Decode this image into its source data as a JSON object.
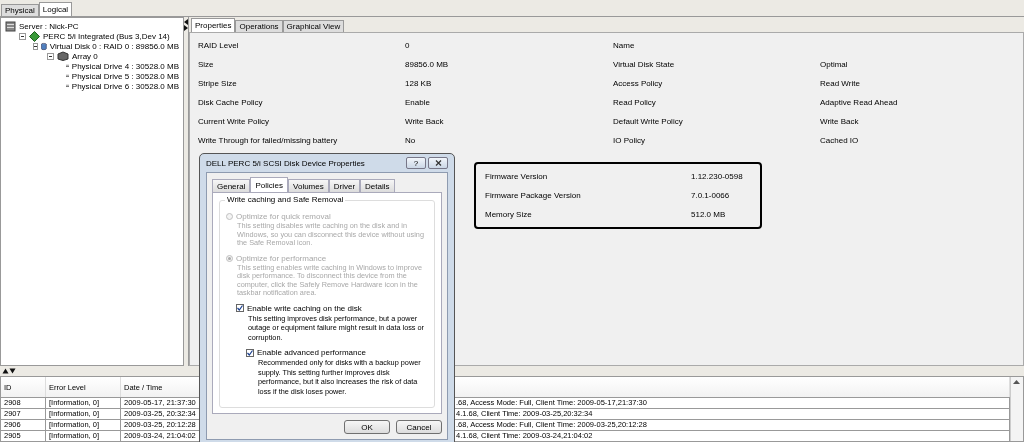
{
  "view_tabs": [
    {
      "label": "Physical",
      "selected": false
    },
    {
      "label": "Logical",
      "selected": true
    }
  ],
  "tree": [
    {
      "label": "Server : Nick-PC",
      "kind": "server",
      "children": [
        {
          "label": "PERC 5/i Integrated (Bus 3,Dev 14)",
          "kind": "controller",
          "expanded": true,
          "children": [
            {
              "label": "Virtual Disk 0 : RAID 0 : 89856.0 MB",
              "kind": "vdisk",
              "expanded": true,
              "children": [
                {
                  "label": "Array 0",
                  "kind": "array",
                  "expanded": true,
                  "children": [
                    {
                      "label": "Physical Drive 4 : 30528.0 MB",
                      "kind": "drive"
                    },
                    {
                      "label": "Physical Drive 5 : 30528.0 MB",
                      "kind": "drive"
                    },
                    {
                      "label": "Physical Drive 6 : 30528.0 MB",
                      "kind": "drive"
                    }
                  ]
                }
              ]
            }
          ]
        }
      ]
    }
  ],
  "detail_tabs": [
    {
      "label": "Properties",
      "selected": true
    },
    {
      "label": "Operations",
      "selected": false
    },
    {
      "label": "Graphical View",
      "selected": false
    }
  ],
  "properties": [
    {
      "label": "RAID Level",
      "value": "0"
    },
    {
      "label": "Name"
    },
    {
      "label": "Size",
      "value": "89856.0 MB"
    },
    {
      "label": "Virtual Disk State",
      "value": "Optimal"
    },
    {
      "label": "Stripe Size",
      "value": "128 KB"
    },
    {
      "label": "Access Policy",
      "value": "Read Write"
    },
    {
      "label": "Disk Cache Policy",
      "value": "Enable"
    },
    {
      "label": "Read Policy",
      "value": "Adaptive Read Ahead"
    },
    {
      "label": "Current Write Policy",
      "value": "Write Back"
    },
    {
      "label": "Default Write Policy",
      "value": "Write Back"
    },
    {
      "label": "Write Through for failed/missing battery",
      "value": "No"
    },
    {
      "label": "IO Policy",
      "value": "Cached IO"
    }
  ],
  "highlighted_properties": [
    {
      "label": "Firmware Version",
      "value": "1.12.230-0598"
    },
    {
      "label": "Firmware Package Version",
      "value": "7.0.1-0066"
    },
    {
      "label": "Memory Size",
      "value": "512.0 MB"
    }
  ],
  "log": {
    "columns": [
      "ID",
      "Error Level",
      "Date / Time"
    ],
    "rows": [
      {
        "id": "2908",
        "level": "[Information, 0]",
        "time": "2009-05-17, 21:37:30",
        "description": ".68,   Access Mode:  Full, Client Time:  2009-05-17,21:37:30"
      },
      {
        "id": "2907",
        "level": "[Information, 0]",
        "time": "2009-03-25, 20:32:34",
        "description": "4.1.68,   Client Time:  2009-03-25,20:32:34"
      },
      {
        "id": "2906",
        "level": "[Information, 0]",
        "time": "2009-03-25, 20:12:28",
        "description": ".68,   Access Mode:  Full, Client Time:  2009-03-25,20:12:28"
      },
      {
        "id": "2905",
        "level": "[Information, 0]",
        "time": "2009-03-24, 21:04:02",
        "description": "4.1.68,   Client Time:  2009-03-24,21:04:02"
      }
    ]
  },
  "dialog": {
    "title": "DELL PERC 5/i SCSI Disk Device Properties",
    "help": "?",
    "tabs": [
      {
        "label": "General",
        "selected": false
      },
      {
        "label": "Policies",
        "selected": true
      },
      {
        "label": "Volumes",
        "selected": false
      },
      {
        "label": "Driver",
        "selected": false
      },
      {
        "label": "Details",
        "selected": false
      }
    ],
    "group_title": "Write caching and Safe Removal",
    "options": [
      {
        "kind": "radio",
        "label": "Optimize for quick removal",
        "selected": false,
        "disabled": true,
        "description": "This setting disables write caching on the disk and in Windows, so you can disconnect this device without using the Safe Removal icon."
      },
      {
        "kind": "radio",
        "label": "Optimize for performance",
        "selected": true,
        "disabled": true,
        "description": "This setting enables write caching in Windows to improve disk performance. To disconnect this device from the computer, click the Safely Remove Hardware icon in the taskbar notification area."
      },
      {
        "kind": "checkbox",
        "label": "Enable write caching on the disk",
        "checked": true,
        "disabled": false,
        "description": "This setting improves disk performance, but a power outage or equipment failure might result in data loss or corruption."
      },
      {
        "kind": "checkbox",
        "label": "Enable advanced performance",
        "checked": true,
        "disabled": false,
        "description": "Recommended only for disks with a backup power supply. This setting further improves disk performance, but it also increases the risk of data loss if the disk loses power."
      }
    ],
    "buttons": [
      "OK",
      "Cancel"
    ]
  }
}
